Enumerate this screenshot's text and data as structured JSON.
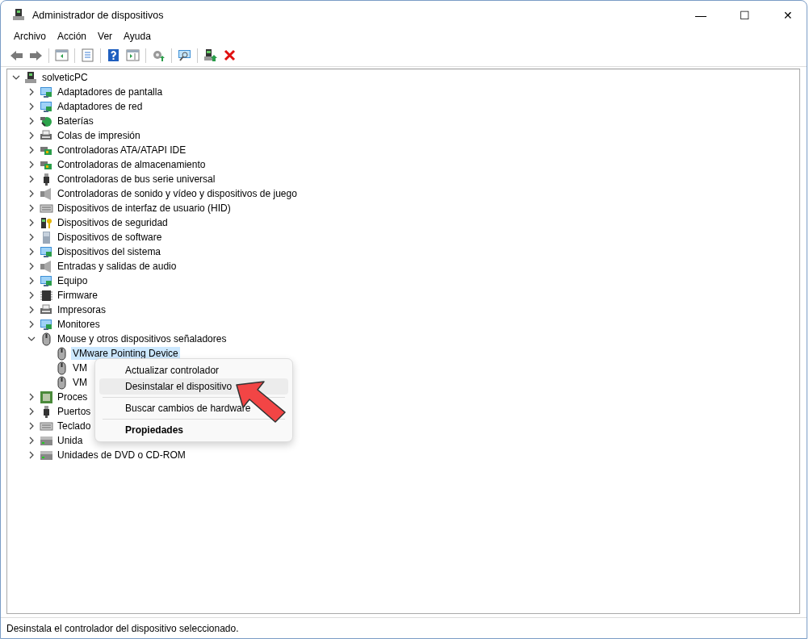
{
  "window": {
    "title": "Administrador de dispositivos",
    "controls": [
      "—",
      "☐",
      "✕"
    ]
  },
  "menu_bar": [
    "Archivo",
    "Acción",
    "Ver",
    "Ayuda"
  ],
  "toolbar": [
    {
      "kind": "back",
      "disabled": false
    },
    {
      "kind": "forward",
      "disabled": false
    },
    {
      "kind": "separator"
    },
    {
      "kind": "tree"
    },
    {
      "kind": "separator"
    },
    {
      "kind": "properties"
    },
    {
      "kind": "separator"
    },
    {
      "kind": "help"
    },
    {
      "kind": "view"
    },
    {
      "kind": "separator"
    },
    {
      "kind": "update"
    },
    {
      "kind": "separator"
    },
    {
      "kind": "scan"
    },
    {
      "kind": "separator"
    },
    {
      "kind": "enable"
    },
    {
      "kind": "uninstall"
    }
  ],
  "tree": {
    "label": "solveticPC",
    "expanded": true,
    "selected": false,
    "children": [
      {
        "label": "Adaptadores de pantalla",
        "expanded": false,
        "selected": false
      },
      {
        "label": "Adaptadores de red",
        "expanded": false,
        "selected": false
      },
      {
        "label": "Baterías",
        "expanded": false,
        "selected": false
      },
      {
        "label": "Colas de impresión",
        "expanded": false,
        "selected": false
      },
      {
        "label": "Controladoras ATA/ATAPI IDE",
        "expanded": false,
        "selected": false
      },
      {
        "label": "Controladoras de almacenamiento",
        "expanded": false,
        "selected": false
      },
      {
        "label": "Controladoras de bus serie universal",
        "expanded": false,
        "selected": false
      },
      {
        "label": "Controladoras de sonido y vídeo y dispositivos de juego",
        "expanded": false,
        "selected": false
      },
      {
        "label": "Dispositivos de interfaz de usuario (HID)",
        "expanded": false,
        "selected": false
      },
      {
        "label": "Dispositivos de seguridad",
        "expanded": false,
        "selected": false
      },
      {
        "label": "Dispositivos de software",
        "expanded": false,
        "selected": false
      },
      {
        "label": "Dispositivos del sistema",
        "expanded": false,
        "selected": false
      },
      {
        "label": "Entradas y salidas de audio",
        "expanded": false,
        "selected": false
      },
      {
        "label": "Equipo",
        "expanded": false,
        "selected": false
      },
      {
        "label": "Firmware",
        "expanded": false,
        "selected": false
      },
      {
        "label": "Impresoras",
        "expanded": false,
        "selected": false
      },
      {
        "label": "Monitores",
        "expanded": false,
        "selected": false
      },
      {
        "label": "Mouse y otros dispositivos señaladores",
        "expanded": true,
        "selected": false,
        "children": [
          {
            "label": "VMware Pointing Device",
            "selected": true
          },
          {
            "label": "VM",
            "selected": false
          },
          {
            "label": "VM",
            "selected": false
          }
        ]
      },
      {
        "label": "Proces",
        "expanded": false,
        "selected": false
      },
      {
        "label": "Puertos",
        "expanded": false,
        "selected": false
      },
      {
        "label": "Teclado",
        "expanded": false,
        "selected": false
      },
      {
        "label": "Unida",
        "expanded": false,
        "selected": false
      },
      {
        "label": "Unidades de DVD o CD-ROM",
        "expanded": false,
        "selected": false
      }
    ]
  },
  "context_menu": [
    {
      "kind": "item",
      "label": "Actualizar controlador",
      "highlighted": false,
      "default": false
    },
    {
      "kind": "item",
      "label": "Desinstalar el dispositivo",
      "highlighted": true,
      "default": false
    },
    {
      "kind": "separator"
    },
    {
      "kind": "item",
      "label": "Buscar cambios de hardware",
      "highlighted": false,
      "default": false
    },
    {
      "kind": "separator"
    },
    {
      "kind": "item",
      "label": "Propiedades",
      "highlighted": false,
      "default": true
    }
  ],
  "status_bar": "Desinstala el controlador del dispositivo seleccionado."
}
